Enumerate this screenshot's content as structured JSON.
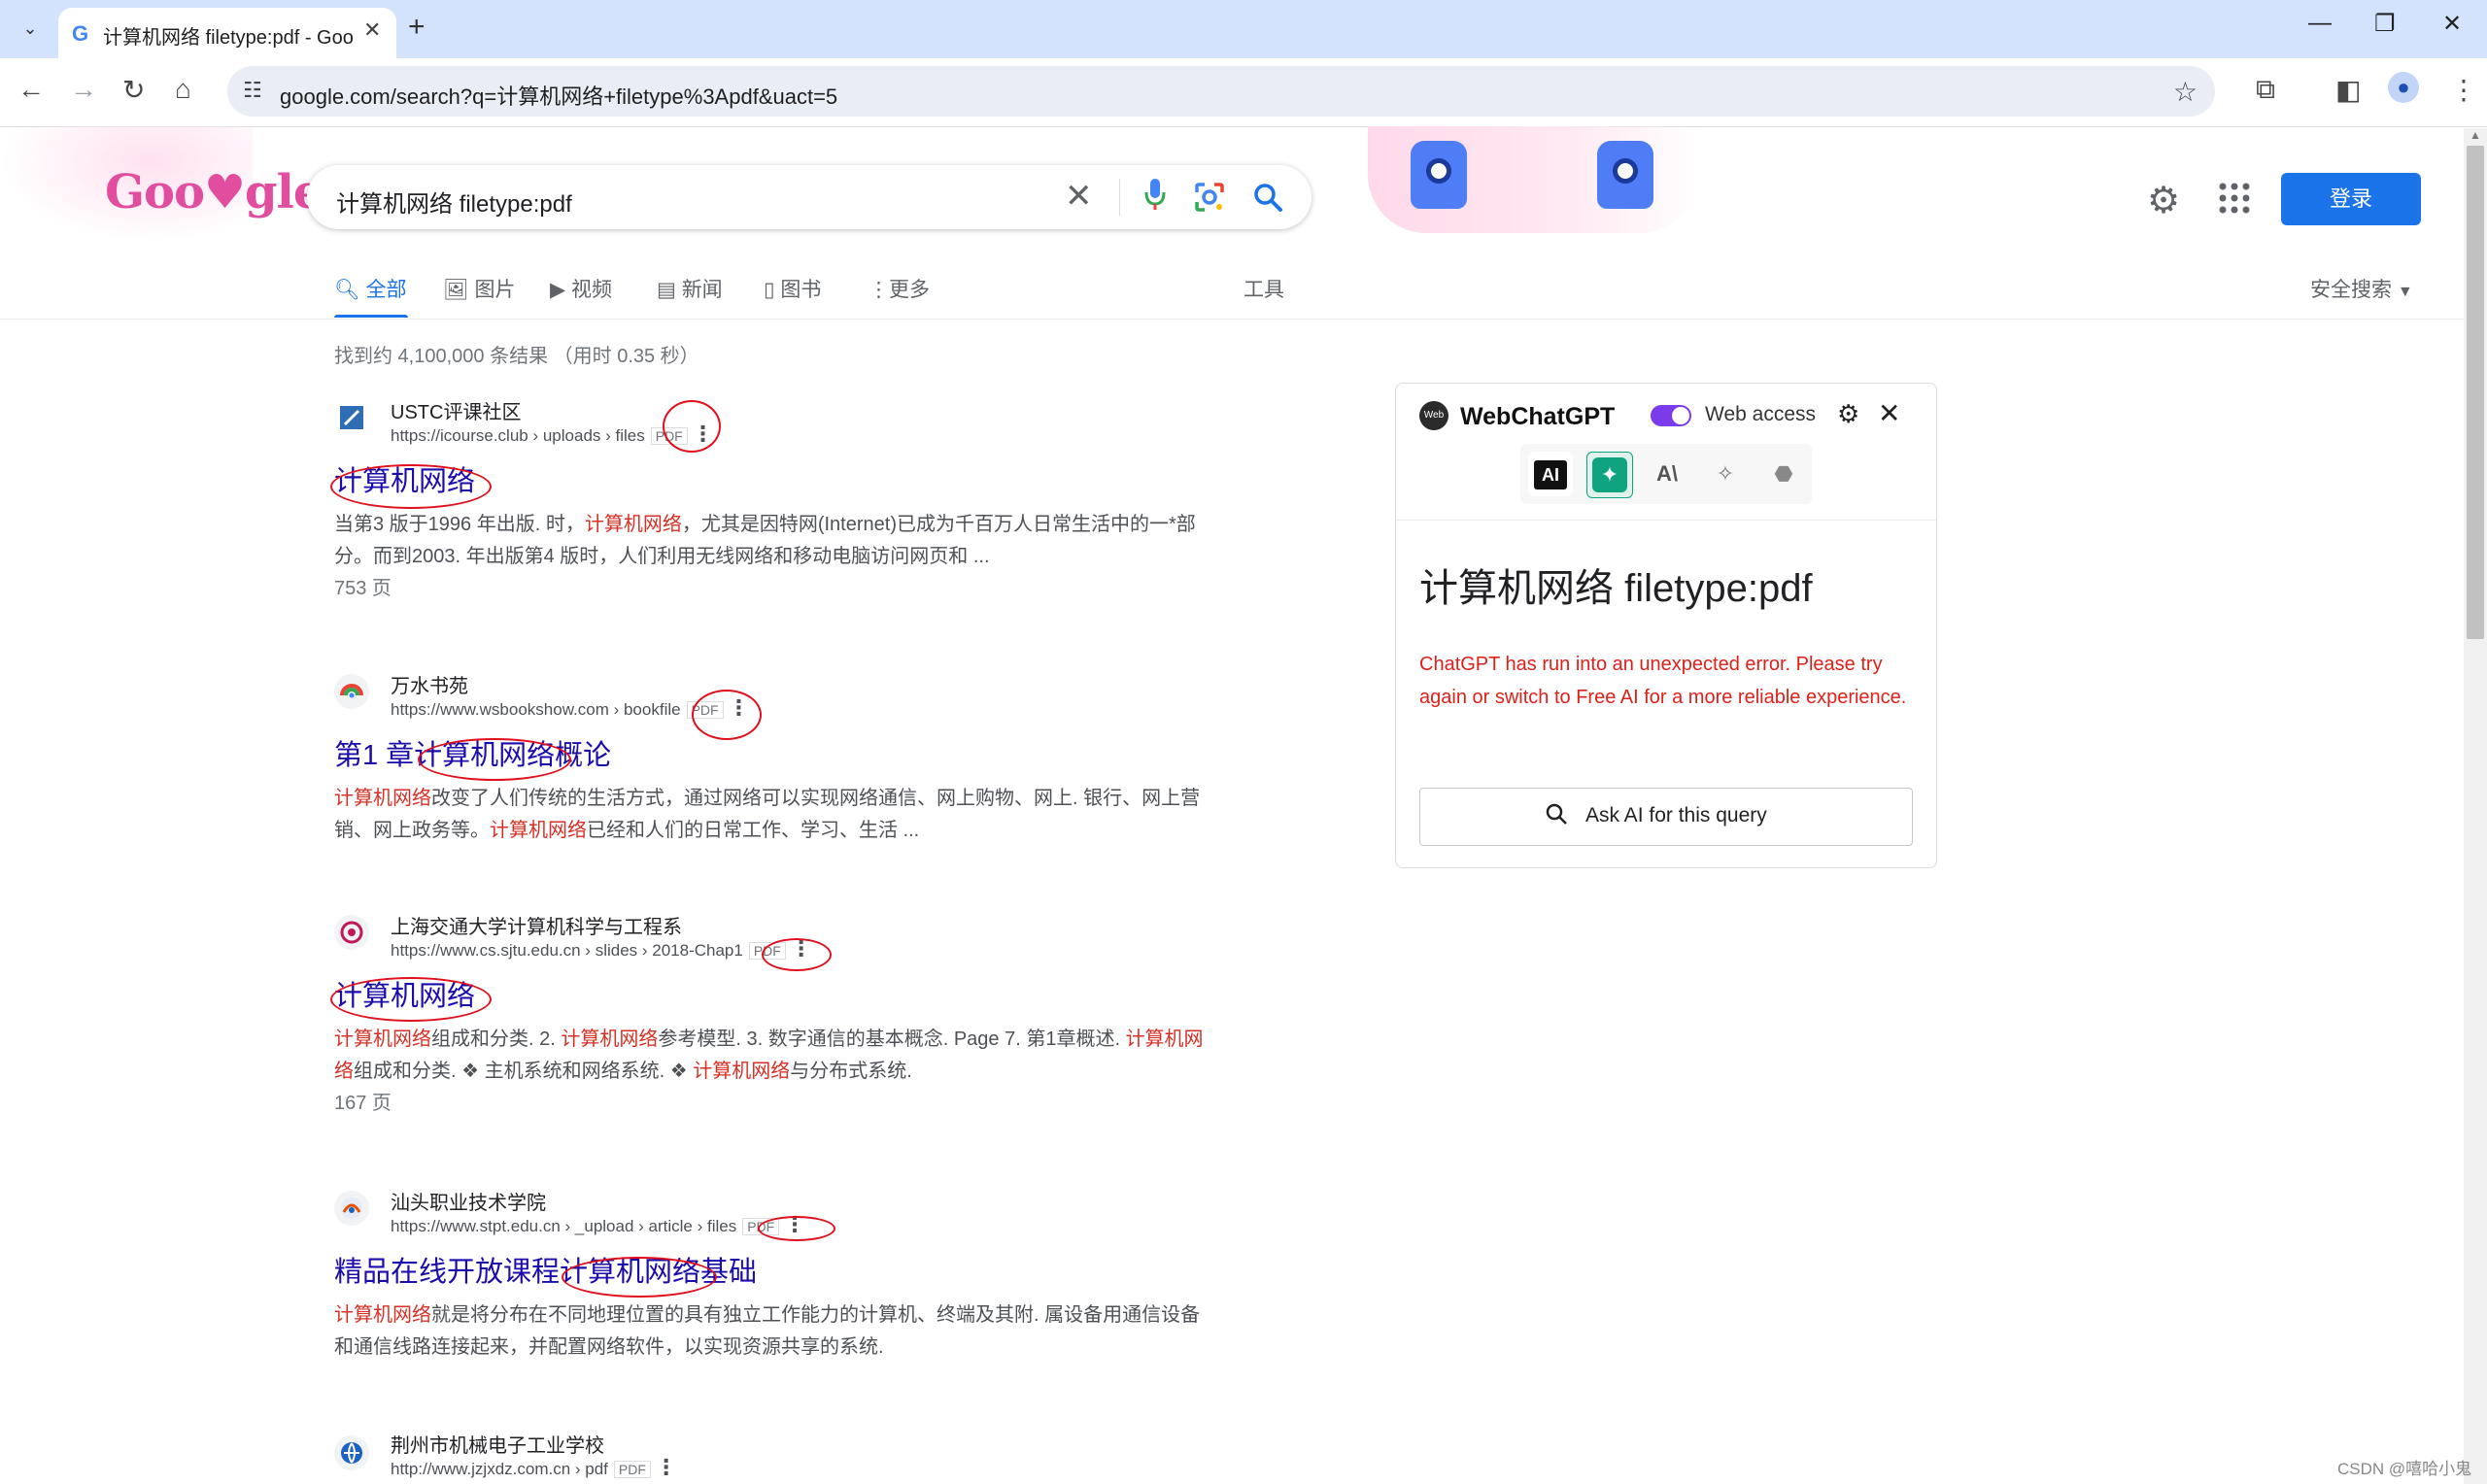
{
  "browser": {
    "tab_title": "计算机网络 filetype:pdf - Goo",
    "tab_close": "✕",
    "tab_list_icon": "⌄",
    "new_tab": "+",
    "win_min": "—",
    "win_max": "❐",
    "win_close": "✕",
    "url": "google.com/search?q=计算机网络+filetype%3Apdf&uact=5"
  },
  "google": {
    "logo": "Goo♥gle",
    "query": "计算机网络 filetype:pdf",
    "login": "登录",
    "tabs": [
      {
        "label": "全部",
        "icon": "search-icon"
      },
      {
        "label": "图片",
        "icon": "image-icon"
      },
      {
        "label": "视频",
        "icon": "video-icon"
      },
      {
        "label": "新闻",
        "icon": "news-icon"
      },
      {
        "label": "图书",
        "icon": "book-icon"
      },
      {
        "label": "更多",
        "icon": "more-vert-icon"
      }
    ],
    "tools": "工具",
    "safesearch": "安全搜索",
    "result_stats": "找到约 4,100,000 条结果 （用时 0.35 秒）"
  },
  "results": [
    {
      "site": "USTC评课社区",
      "url": "https://icourse.club › uploads › files",
      "pdf": "PDF",
      "title": "计算机网络",
      "snippet_html": "当第3 版于1996 年出版. 时，<em>计算机网络</em>，尤其是因特网(Internet)已成为千百万人日常生活中的一*部分。而到2003. 年出版第4 版时，人们利用无线网络和移动电脑访问网页和 ...",
      "pages": "753 页"
    },
    {
      "site": "万水书苑",
      "url": "https://www.wsbookshow.com › bookfile",
      "pdf": "PDF",
      "title": "第1 章计算机网络概论",
      "snippet_html": "<em>计算机网络</em>改变了人们传统的生活方式，通过网络可以实现网络通信、网上购物、网上. 银行、网上营销、网上政务等。<em>计算机网络</em>已经和人们的日常工作、学习、生活 ...",
      "pages": ""
    },
    {
      "site": "上海交通大学计算机科学与工程系",
      "url": "https://www.cs.sjtu.edu.cn › slides › 2018-Chap1",
      "pdf": "PDF",
      "title": "计算机网络",
      "snippet_html": "<em>计算机网络</em>组成和分类. 2. <em>计算机网络</em>参考模型. 3. 数字通信的基本概念. Page 7. 第1章概述. <em>计算机网络</em>组成和分类. ❖ 主机系统和网络系统. ❖ <em>计算机网络</em>与分布式系统.",
      "pages": "167 页"
    },
    {
      "site": "汕头职业技术学院",
      "url": "https://www.stpt.edu.cn › _upload › article › files",
      "pdf": "PDF",
      "title": "精品在线开放课程计算机网络基础",
      "snippet_html": "<em>计算机网络</em>就是将分布在不同地理位置的具有独立工作能力的计算机、终端及其附. 属设备用通信设备和通信线路连接起来，并配置网络软件，以实现资源共享的系统.",
      "pages": ""
    },
    {
      "site": "荆州市机械电子工业学校",
      "url": "http://www.jzjxdz.com.cn › pdf",
      "pdf": "PDF",
      "title": "",
      "snippet_html": "",
      "pages": ""
    }
  ],
  "webchatgpt": {
    "logo_text": "Web",
    "title": "WebChatGPT",
    "web_access": "Web access",
    "models": [
      "AI",
      "✦",
      "A\\",
      "✧",
      "⬣"
    ],
    "query": "计算机网络 filetype:pdf",
    "error": "ChatGPT has run into an unexpected error. Please try again or switch to Free AI for a more reliable experience.",
    "ask_button": "Ask AI for this query"
  },
  "watermark": "CSDN @嘻哈小鬼"
}
